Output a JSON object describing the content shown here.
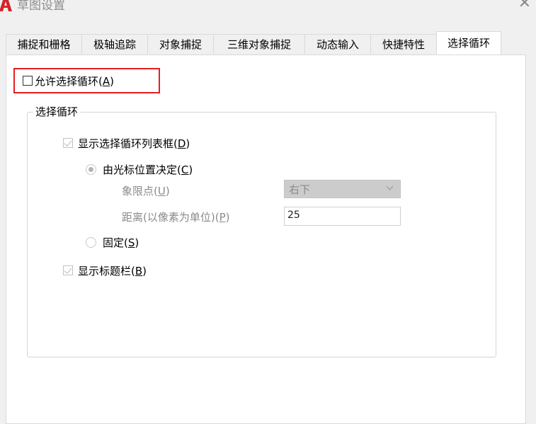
{
  "window": {
    "title": "草图设置",
    "app_icon": "autocad-a-logo",
    "close_icon": "close-icon",
    "close_glyph": "✕"
  },
  "tabs": [
    {
      "label": "捕捉和栅格",
      "active": false
    },
    {
      "label": "极轴追踪",
      "active": false
    },
    {
      "label": "对象捕捉",
      "active": false
    },
    {
      "label": "三维对象捕捉",
      "active": false
    },
    {
      "label": "动态输入",
      "active": false
    },
    {
      "label": "快捷特性",
      "active": false
    },
    {
      "label": "选择循环",
      "active": true
    }
  ],
  "allow_cycling": {
    "checked": false,
    "label_pre": "允许选择循环(",
    "key": "A",
    "label_post": ")"
  },
  "group": {
    "title": "选择循环",
    "show_list": {
      "checked": true,
      "label_pre": "显示选择循环列表框(",
      "key": "D",
      "label_post": ")"
    },
    "by_cursor": {
      "selected": true,
      "label_pre": "由光标位置决定(",
      "key": "C",
      "label_post": ")"
    },
    "quadrant": {
      "label_pre": "象限点(",
      "key": "U",
      "label_post": ")",
      "value": "右下"
    },
    "distance": {
      "label_pre": "距离(以像素为单位)(",
      "key": "P",
      "label_post": ")",
      "value": "25"
    },
    "fixed": {
      "selected": false,
      "label_pre": "固定(",
      "key": "S",
      "label_post": ")"
    },
    "show_titlebar": {
      "checked": true,
      "label_pre": "显示标题栏(",
      "key": "B",
      "label_post": ")"
    }
  },
  "colors": {
    "highlight": "#e51f1f",
    "logo": "#d4232b",
    "disabled_text": "#8a8a8a"
  }
}
